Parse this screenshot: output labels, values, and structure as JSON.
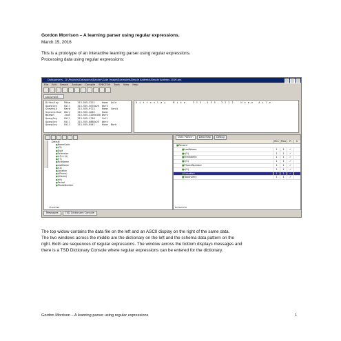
{
  "doc": {
    "title": "Gordon Morrison – A learning parser using regular expressions.",
    "date": "March 15, 2016",
    "intro": [
      "This is a prototype of an interactive learning parser using regular expressions.",
      "Processing data using regular expressions:"
    ],
    "body": [
      "The top widow contains the data file on the left and an ASCII display on the right of the same data.",
      "The two windows across the middle are the dictionary on the left and the schema data pattern on the",
      "right. Both are sequences of regular expressions. The window across the bottom displays messages and",
      "there is a TSD Dictionary Console where regular expressions can be entered for the dictionary."
    ],
    "footer_left": "Gordon Morrison – A learning parser using regular expressions",
    "page_number": "1"
  },
  "screenshot": {
    "window_title": "Dataparsers - D:\\Projects\\Dataparse\\Banker\\Gate Image\\Examples\\Simple Address\\Simple Address 2016.prs",
    "menu": [
      "File",
      "Edit",
      "Search",
      "Analyze",
      "Compile",
      "SPECTOR",
      "Tools",
      "View",
      "Help"
    ],
    "document_tab": "Document",
    "data_rows": [
      "Dittoulay    Mike     313-555-3222     Home  Axle",
      "Quongley     Bill     313-555-5678x25  Work",
      "Stevenik     Barb     313-555-9723     Home  Cordi",
      "Sinnensthue  Mary     313-555-4646     Home",
      "Waxmon       Joan     313-555-2200x456 Work",
      "Quongley     Bill     313-555-1748     Cell",
      "Quongley     Bill     313-555-8888x23  Work",
      "Quongley     Bill     313-555-8541     Home  Barb"
    ],
    "ascii_lines": [
      "D i t t o u l a y    M i k e    3 1 3 - 5 5 5 - 3 2 2 2    H o m e   A x l e"
    ],
    "dictionary_root": "Default",
    "dictionary_items": [
      "NameCode",
      "r(2)",
      "Digit",
      "Extension",
      "r(3)+r(4)",
      "r(7)",
      "FirstName",
      "LastName",
      "r(4)",
      "Location",
      "r(Phone)",
      "r(Name)",
      "r(N)",
      "Period",
      "PhoneNumber"
    ],
    "dictionary_status": "15 entries",
    "schema_tabs": [
      "Data Pattern",
      "Data Map",
      "Debug"
    ],
    "schema_columns": [
      "Min",
      "Max",
      "R",
      "Ir"
    ],
    "schema_root": "Record",
    "schema_rows": [
      {
        "name": "LastName",
        "min": "1",
        "max": "1",
        "r": "✓",
        "sel": false
      },
      {
        "name": "r(5)",
        "min": "1",
        "max": "1",
        "r": "✓",
        "sel": false
      },
      {
        "name": "FirstName",
        "min": "1",
        "max": "1",
        "r": "✓",
        "sel": false
      },
      {
        "name": "r(5)",
        "min": "1",
        "max": "1",
        "r": "✓",
        "sel": false
      },
      {
        "name": "PhoneNumber",
        "min": "1",
        "max": "1",
        "r": "✓",
        "sel": false
      },
      {
        "name": "r(5)",
        "min": "1",
        "max": "1",
        "r": "✓",
        "sel": false
      },
      {
        "name": "Location",
        "min": "1",
        "max": "1",
        "r": "✓",
        "sel": true
      },
      {
        "name": "Taxonomy",
        "min": "1",
        "max": "1",
        "r": "✓",
        "sel": false
      }
    ],
    "schema_status": "No Records",
    "bottom_tabs": [
      "Messages",
      "TSD Dictionary Console"
    ]
  }
}
